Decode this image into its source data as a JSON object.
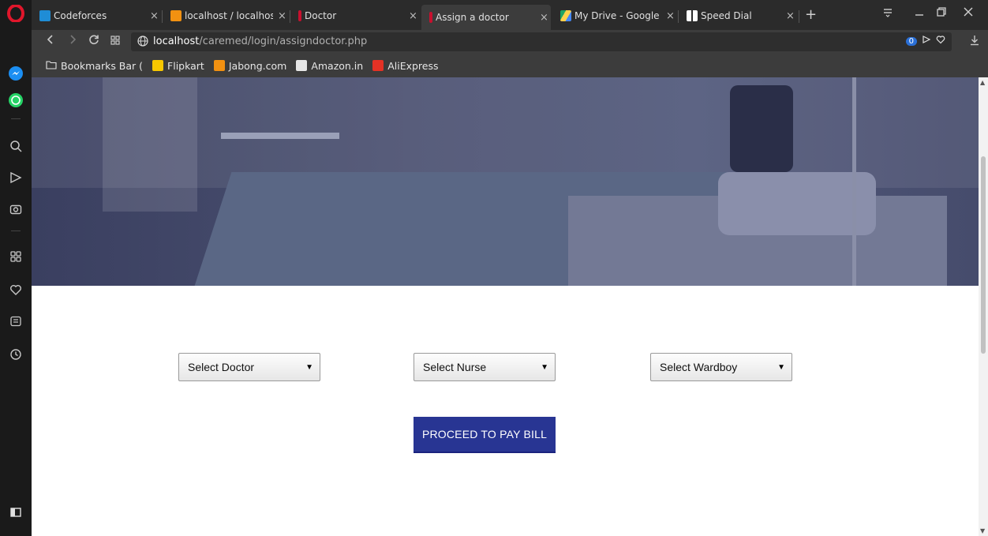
{
  "browser": {
    "tabs": [
      {
        "title": "Codeforces",
        "favicon_color": "#1f8dd6"
      },
      {
        "title": "localhost / localhos",
        "favicon_color": "#f29111"
      },
      {
        "title": "Doctor",
        "favicon_color": "#c8102e"
      },
      {
        "title": "Assign a doctor",
        "favicon_color": "#c8102e",
        "active": true
      },
      {
        "title": "My Drive - Google",
        "favicon_color": "#1fa463"
      },
      {
        "title": "Speed Dial",
        "favicon_color": "#ffffff"
      }
    ],
    "close_glyph": "×",
    "new_tab_glyph": "+",
    "address": {
      "host": "localhost",
      "path": "/caremed/login/assigndoctor.php",
      "badge_count": "0"
    },
    "bookmarks": [
      {
        "label": "Bookmarks Bar (",
        "icon": "folder-icon"
      },
      {
        "label": "Flipkart",
        "icon": "flipkart-icon",
        "color": "#f8c800"
      },
      {
        "label": "Jabong.com",
        "icon": "jabong-icon",
        "color": "#f29111"
      },
      {
        "label": "Amazon.in",
        "icon": "amazon-icon",
        "color": "#e6e6e6"
      },
      {
        "label": "AliExpress",
        "icon": "aliexpress-icon",
        "color": "#e43225"
      }
    ]
  },
  "form": {
    "doctor_select": "Select Doctor",
    "nurse_select": "Select Nurse",
    "wardboy_select": "Select Wardboy",
    "submit_label": "PROCEED TO PAY BILL"
  },
  "colors": {
    "button_bg": "#283593",
    "hero_tint": "#3a3f60"
  }
}
